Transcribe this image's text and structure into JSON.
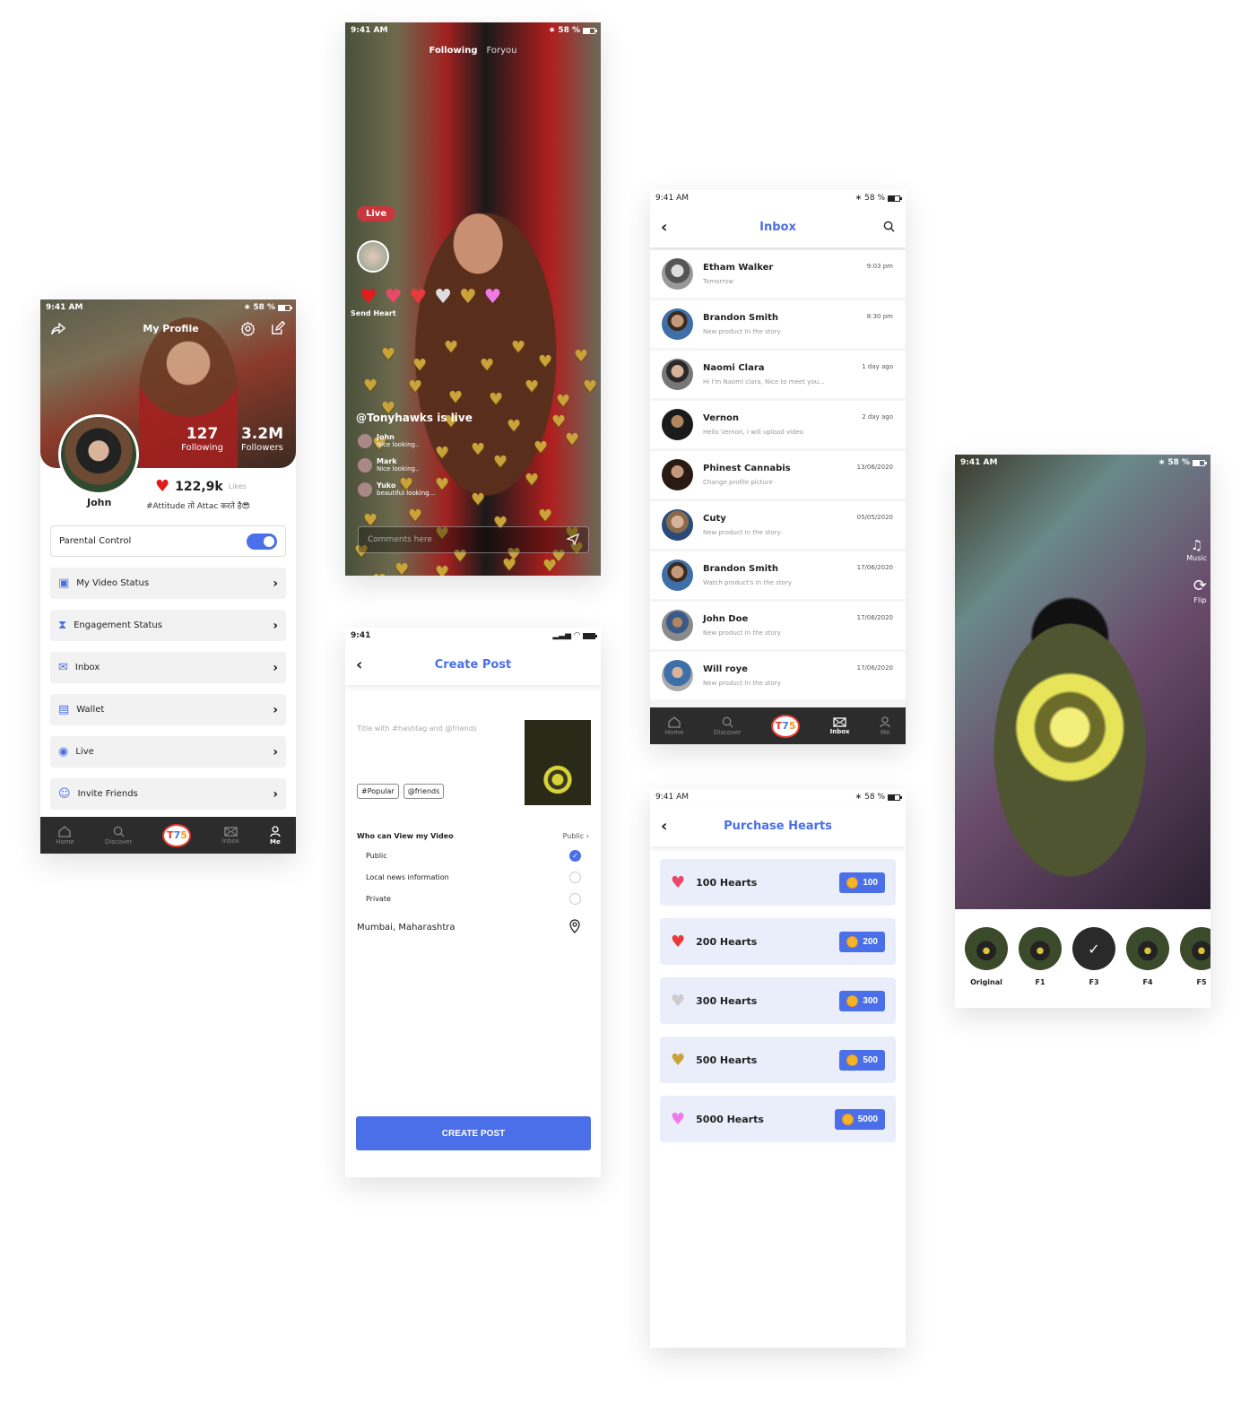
{
  "status": {
    "time": "9:41 AM",
    "battery": "58 %",
    "short_time": "9:41"
  },
  "profile": {
    "title": "My Profile",
    "following_count": "127",
    "following_label": "Following",
    "followers_count": "3.2M",
    "followers_label": "Followers",
    "likes_count": "122,9k",
    "likes_label": "Likes",
    "name": "John",
    "bio": "#Attitude तो Attac करते है😎",
    "parental_control": {
      "label": "Parental Control",
      "enabled": true
    },
    "menu": [
      {
        "label": "My Video Status",
        "icon": "video-icon"
      },
      {
        "label": "Engagement Status",
        "icon": "hourglass-icon"
      },
      {
        "label": "Inbox",
        "icon": "mail-icon"
      },
      {
        "label": "Wallet",
        "icon": "wallet-icon"
      },
      {
        "label": "Live",
        "icon": "live-icon"
      },
      {
        "label": "Invite Friends",
        "icon": "add-users-icon"
      }
    ]
  },
  "nav": {
    "items": [
      {
        "label": "Home"
      },
      {
        "label": "Discover"
      },
      {
        "label": "T75"
      },
      {
        "label": "Inbox"
      },
      {
        "label": "Me"
      }
    ],
    "logo": [
      "T",
      "7",
      "5"
    ]
  },
  "live": {
    "tabs": [
      "Following",
      "Foryou"
    ],
    "badge": "Live",
    "send_heart": "Send Heart",
    "heart_options": [
      "❤",
      "💝",
      "💖",
      "🤍",
      "💛",
      "💜"
    ],
    "stream_title": "@Tonyhawks is live",
    "comments": [
      {
        "name": "John",
        "text": "Nice looking.."
      },
      {
        "name": "Mark",
        "text": "Nice looking.."
      },
      {
        "name": "Yuko",
        "text": "beautiful looking..."
      }
    ],
    "comment_placeholder": "Comments here"
  },
  "create_post": {
    "title": "Create Post",
    "caption_placeholder": "Title with #hashtag and @friends",
    "tags": [
      "#Popular",
      "@friends"
    ],
    "visibility_label": "Who can View my  Video",
    "visibility_value": "Public",
    "options": [
      {
        "label": "Public",
        "selected": true
      },
      {
        "label": "Local news information",
        "selected": false
      },
      {
        "label": "Private",
        "selected": false
      }
    ],
    "location": "Mumbai, Maharashtra",
    "button": "CREATE POST"
  },
  "inbox": {
    "title": "Inbox",
    "messages": [
      {
        "name": "Etham Walker",
        "preview": "Tomorrow",
        "time": "9:03 pm"
      },
      {
        "name": "Brandon Smith",
        "preview": "New product In the story",
        "time": "8:30 pm"
      },
      {
        "name": "Naomi Clara",
        "preview": "Hi I'm Naomi clara, Nice to meet you...",
        "time": "1 day ago"
      },
      {
        "name": "Vernon",
        "preview": "Hello Vernon, I will upload video",
        "time": "2 day ago"
      },
      {
        "name": "Phinest Cannabis",
        "preview": "Change profile picture",
        "time": "13/06/2020"
      },
      {
        "name": "Cuty",
        "preview": "New product In the story",
        "time": "05/05/2020"
      },
      {
        "name": "Brandon Smith",
        "preview": "Watch product's In the story",
        "time": "17/06/2020"
      },
      {
        "name": "John Doe",
        "preview": "New product In the story",
        "time": "17/06/2020"
      },
      {
        "name": "Will roye",
        "preview": "New product In the story",
        "time": "17/06/2020"
      }
    ]
  },
  "purchase": {
    "title": "Purchase Hearts",
    "packs": [
      {
        "label": "100 Hearts",
        "price": "100",
        "icon": "💝",
        "color": "#e84a6a"
      },
      {
        "label": "200 Hearts",
        "price": "200",
        "icon": "❤",
        "color": "#e83a3a"
      },
      {
        "label": "300 Hearts",
        "price": "300",
        "icon": "🤍",
        "color": "#cccccc"
      },
      {
        "label": "500 Hearts",
        "price": "500",
        "icon": "💛",
        "color": "#c9a33a"
      },
      {
        "label": "5000 Hearts",
        "price": "5000",
        "icon": "💜",
        "color": "#f07ae8"
      }
    ]
  },
  "filter": {
    "side": [
      {
        "label": "Music",
        "icon": "♫"
      },
      {
        "label": "Flip",
        "icon": "⟳"
      }
    ],
    "filters": [
      {
        "label": "Original",
        "selected": false
      },
      {
        "label": "F1",
        "selected": false
      },
      {
        "label": "F3",
        "selected": true
      },
      {
        "label": "F4",
        "selected": false
      },
      {
        "label": "F5",
        "selected": false
      }
    ]
  },
  "colors": {
    "accent": "#4a6fe8",
    "nav_bg": "#2c2c2c",
    "live_red": "#c8373d",
    "card_bg": "#eaeefb"
  }
}
